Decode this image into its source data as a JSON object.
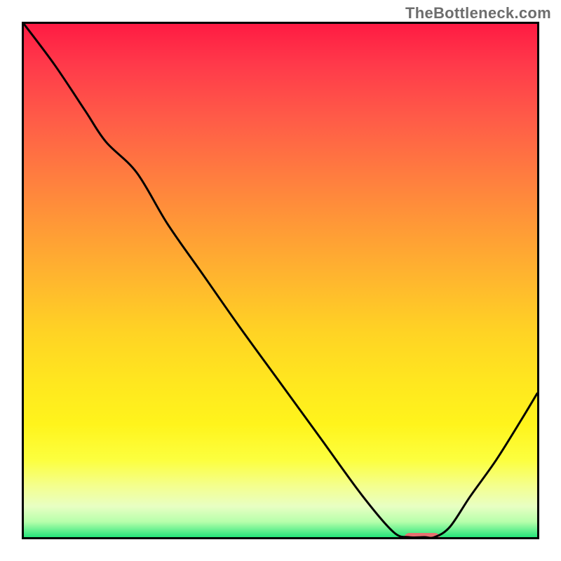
{
  "meta": {
    "watermark": "TheBottleneck.com"
  },
  "chart_data": {
    "type": "line",
    "title": "",
    "xlabel": "",
    "ylabel": "",
    "x_axis": {
      "min": 0,
      "max": 100,
      "ticks": []
    },
    "y_axis": {
      "min": 0,
      "max": 100,
      "ticks": []
    },
    "grid": false,
    "legend": {
      "visible": false
    },
    "background_gradient_meaning": "bottleneck severity (red high, green low)",
    "series": [
      {
        "name": "bottleneck-curve",
        "x": [
          0,
          6,
          12,
          16,
          22,
          28,
          35,
          42,
          50,
          58,
          66,
          72,
          75,
          78,
          80,
          83,
          87,
          92,
          97,
          100
        ],
        "values": [
          100,
          92,
          83,
          77,
          71,
          61,
          51,
          41,
          30,
          19,
          8,
          1,
          0,
          0,
          0,
          2,
          8,
          15,
          23,
          28
        ],
        "color": "#000000",
        "line_width": 3
      }
    ],
    "optimal_marker": {
      "x_center": 77,
      "x_width": 7,
      "y": 0,
      "color": "#e77070"
    }
  }
}
